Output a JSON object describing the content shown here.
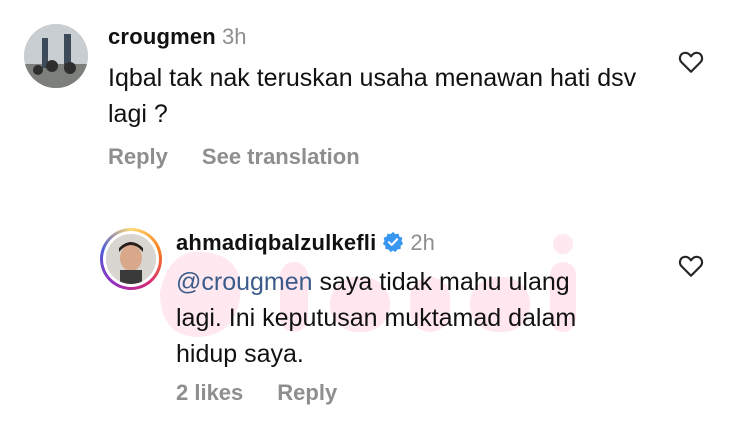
{
  "comments": [
    {
      "username": "crougmen",
      "time": "3h",
      "text": "Iqbal tak nak teruskan usaha menawan hati dsv lagi ?",
      "actions": {
        "reply": "Reply",
        "translate": "See translation"
      }
    },
    {
      "username": "ahmadiqbalzulkefli",
      "time": "2h",
      "mention": "@crougmen",
      "text_line1": " saya tidak mahu ulang",
      "text_line2": "lagi. Ini keputusan muktamad dalam",
      "text_line3": "hidup saya.",
      "actions": {
        "likes": "2 likes",
        "reply": "Reply"
      }
    }
  ],
  "colors": {
    "muted": "#8e8e8e",
    "mention": "#3b5c8a",
    "verified": "#3897f0"
  },
  "icons": [
    "heart-icon",
    "verified-badge-icon"
  ]
}
